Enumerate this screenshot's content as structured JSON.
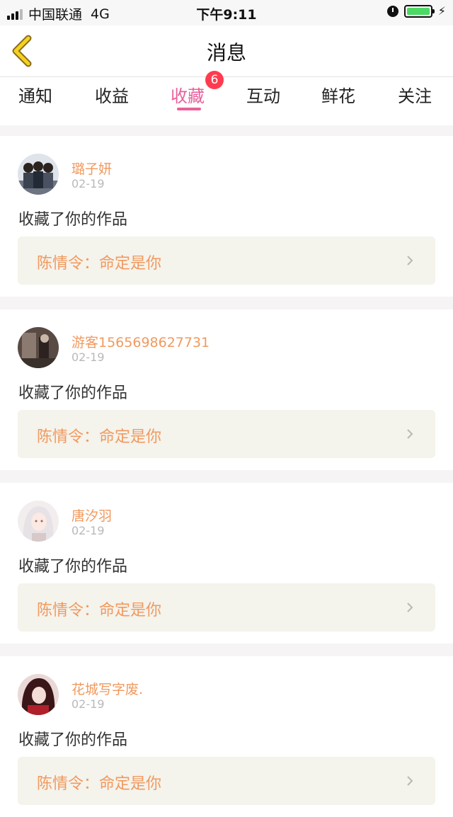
{
  "status_bar": {
    "carrier": "中国联通",
    "network": "4G",
    "time": "下午9:11"
  },
  "header": {
    "title": "消息",
    "back_icon": "chevron-left-icon"
  },
  "tabs": [
    {
      "label": "通知"
    },
    {
      "label": "收益"
    },
    {
      "label": "收藏",
      "active": true,
      "badge": "6"
    },
    {
      "label": "互动"
    },
    {
      "label": "鲜花"
    },
    {
      "label": "关注"
    }
  ],
  "notifications": [
    {
      "username": "璐子妍",
      "date": "02-19",
      "action": "收藏了你的作品",
      "work_title": "陈情令：命定是你"
    },
    {
      "username": "游客1565698627731",
      "date": "02-19",
      "action": "收藏了你的作品",
      "work_title": "陈情令：命定是你"
    },
    {
      "username": "唐汐羽",
      "date": "02-19",
      "action": "收藏了你的作品",
      "work_title": "陈情令：命定是你"
    },
    {
      "username": "花城写字废.",
      "date": "02-19",
      "action": "收藏了你的作品",
      "work_title": "陈情令：命定是你"
    }
  ],
  "colors": {
    "accent_pink": "#e8609a",
    "username_orange": "#f1995e",
    "badge_red": "#ff3b4f",
    "battery_green": "#4cd964"
  }
}
